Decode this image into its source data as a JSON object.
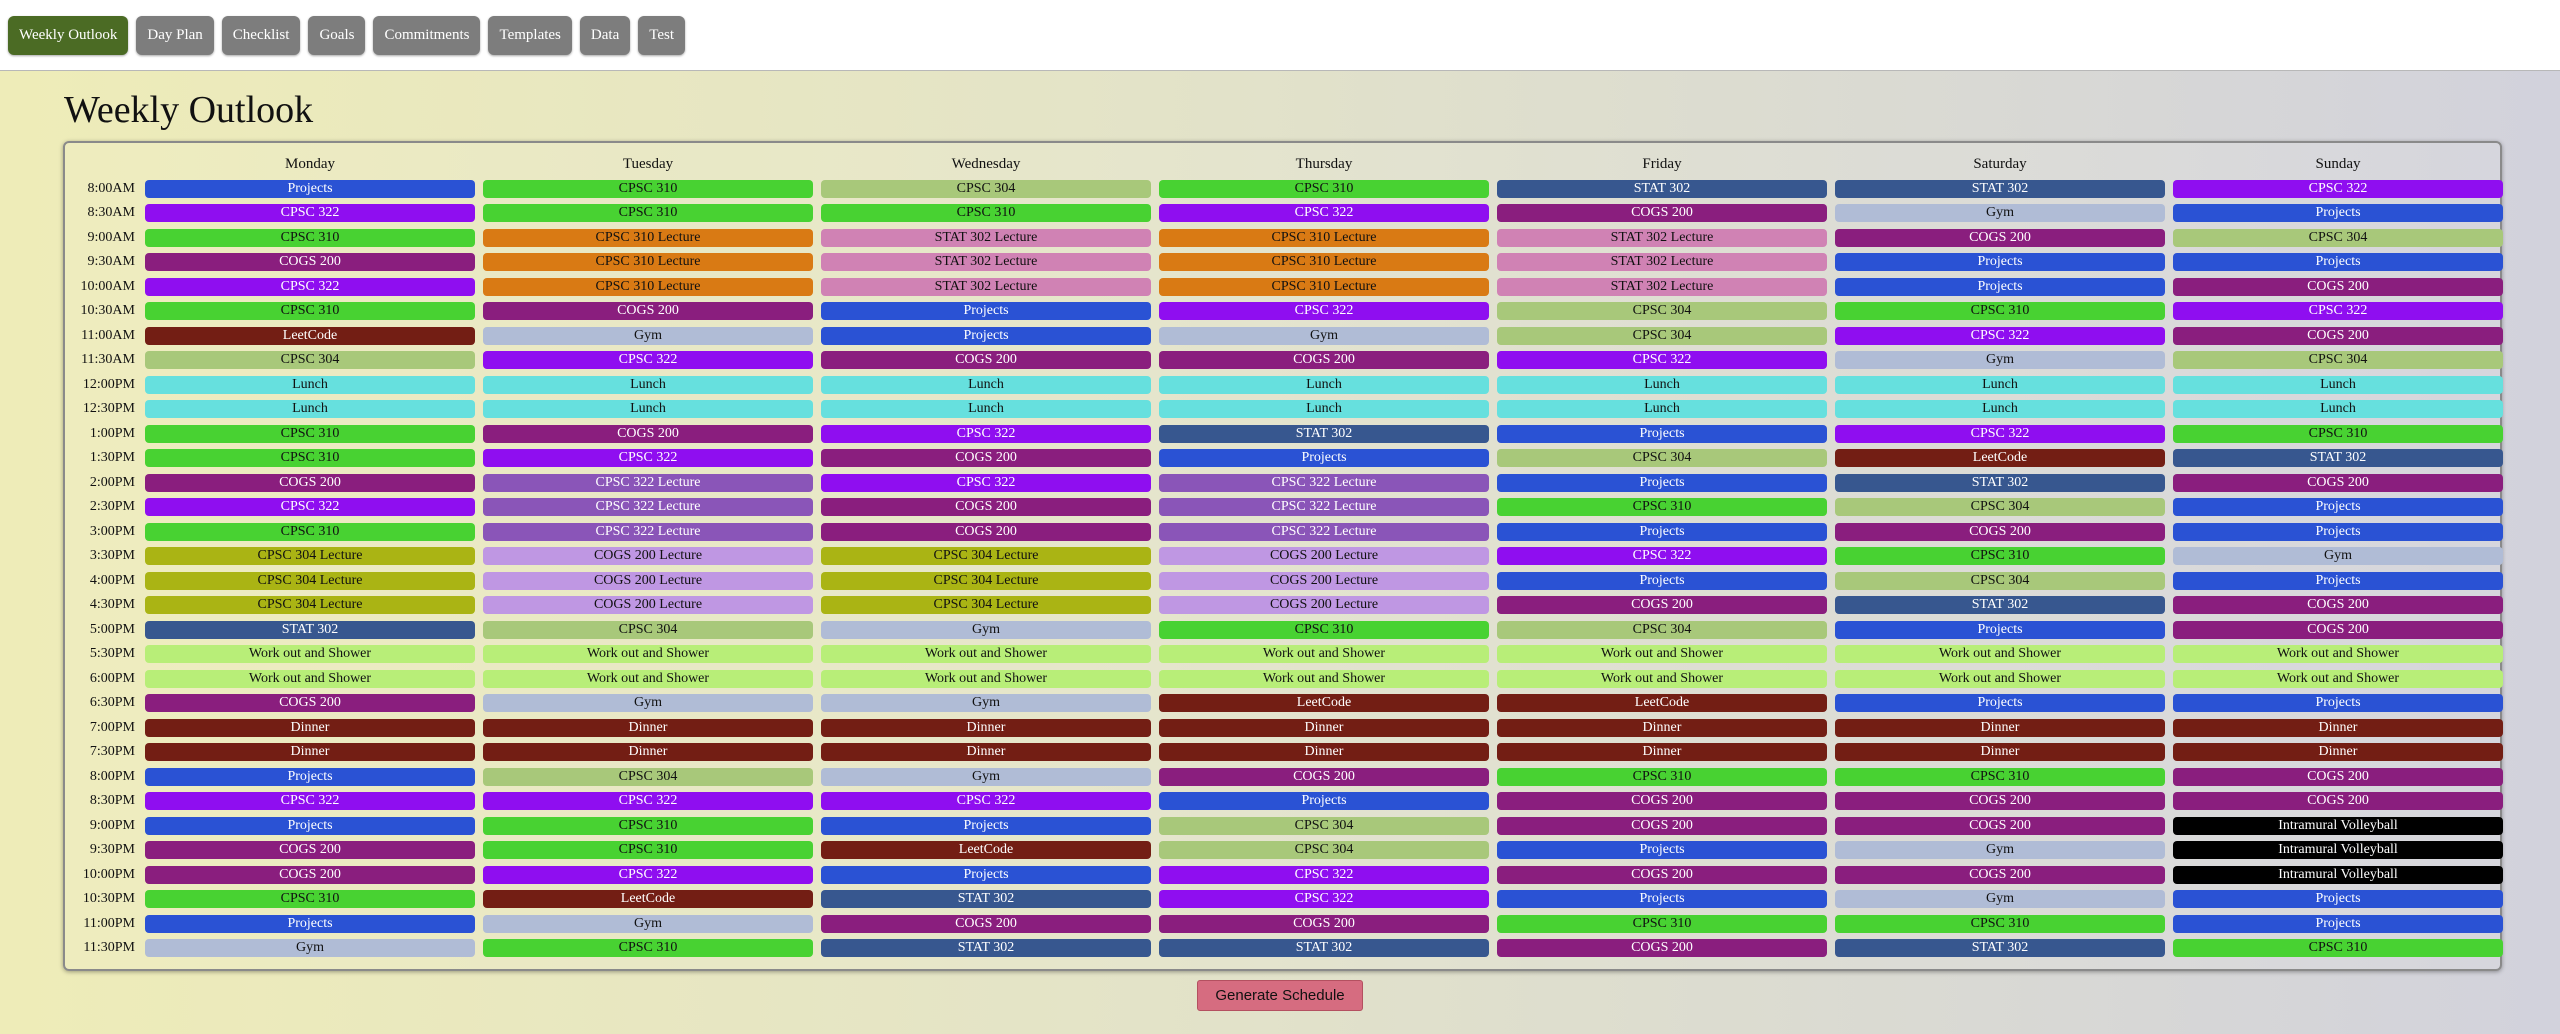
{
  "nav": {
    "items": [
      {
        "label": "Weekly Outlook",
        "active": true
      },
      {
        "label": "Day Plan"
      },
      {
        "label": "Checklist"
      },
      {
        "label": "Goals"
      },
      {
        "label": "Commitments"
      },
      {
        "label": "Templates"
      },
      {
        "label": "Data"
      },
      {
        "label": "Test"
      }
    ]
  },
  "page_title": "Weekly Outlook",
  "schedule": {
    "days": [
      "Monday",
      "Tuesday",
      "Wednesday",
      "Thursday",
      "Friday",
      "Saturday",
      "Sunday"
    ],
    "times": [
      "8:00AM",
      "8:30AM",
      "9:00AM",
      "9:30AM",
      "10:00AM",
      "10:30AM",
      "11:00AM",
      "11:30AM",
      "12:00PM",
      "12:30PM",
      "1:00PM",
      "1:30PM",
      "2:00PM",
      "2:30PM",
      "3:00PM",
      "3:30PM",
      "4:00PM",
      "4:30PM",
      "5:00PM",
      "5:30PM",
      "6:00PM",
      "6:30PM",
      "7:00PM",
      "7:30PM",
      "8:00PM",
      "8:30PM",
      "9:00PM",
      "9:30PM",
      "10:00PM",
      "10:30PM",
      "11:00PM",
      "11:30PM"
    ],
    "rows": [
      [
        "Projects",
        "CPSC 310",
        "CPSC 304",
        "CPSC 310",
        "STAT 302",
        "STAT 302",
        "CPSC 322"
      ],
      [
        "CPSC 322",
        "CPSC 310",
        "CPSC 310",
        "CPSC 322",
        "COGS 200",
        "Gym",
        "Projects"
      ],
      [
        "CPSC 310",
        "CPSC 310 Lecture",
        "STAT 302 Lecture",
        "CPSC 310 Lecture",
        "STAT 302 Lecture",
        "COGS 200",
        "CPSC 304"
      ],
      [
        "COGS 200",
        "CPSC 310 Lecture",
        "STAT 302 Lecture",
        "CPSC 310 Lecture",
        "STAT 302 Lecture",
        "Projects",
        "Projects"
      ],
      [
        "CPSC 322",
        "CPSC 310 Lecture",
        "STAT 302 Lecture",
        "CPSC 310 Lecture",
        "STAT 302 Lecture",
        "Projects",
        "COGS 200"
      ],
      [
        "CPSC 310",
        "COGS 200",
        "Projects",
        "CPSC 322",
        "CPSC 304",
        "CPSC 310",
        "CPSC 322"
      ],
      [
        "LeetCode",
        "Gym",
        "Projects",
        "Gym",
        "CPSC 304",
        "CPSC 322",
        "COGS 200"
      ],
      [
        "CPSC 304",
        "CPSC 322",
        "COGS 200",
        "COGS 200",
        "CPSC 322",
        "Gym",
        "CPSC 304"
      ],
      [
        "Lunch",
        "Lunch",
        "Lunch",
        "Lunch",
        "Lunch",
        "Lunch",
        "Lunch"
      ],
      [
        "Lunch",
        "Lunch",
        "Lunch",
        "Lunch",
        "Lunch",
        "Lunch",
        "Lunch"
      ],
      [
        "CPSC 310",
        "COGS 200",
        "CPSC 322",
        "STAT 302",
        "Projects",
        "CPSC 322",
        "CPSC 310"
      ],
      [
        "CPSC 310",
        "CPSC 322",
        "COGS 200",
        "Projects",
        "CPSC 304",
        "LeetCode",
        "STAT 302"
      ],
      [
        "COGS 200",
        "CPSC 322 Lecture",
        "CPSC 322",
        "CPSC 322 Lecture",
        "Projects",
        "STAT 302",
        "COGS 200"
      ],
      [
        "CPSC 322",
        "CPSC 322 Lecture",
        "COGS 200",
        "CPSC 322 Lecture",
        "CPSC 310",
        "CPSC 304",
        "Projects"
      ],
      [
        "CPSC 310",
        "CPSC 322 Lecture",
        "COGS 200",
        "CPSC 322 Lecture",
        "Projects",
        "COGS 200",
        "Projects"
      ],
      [
        "CPSC 304 Lecture",
        "COGS 200 Lecture",
        "CPSC 304 Lecture",
        "COGS 200 Lecture",
        "CPSC 322",
        "CPSC 310",
        "Gym"
      ],
      [
        "CPSC 304 Lecture",
        "COGS 200 Lecture",
        "CPSC 304 Lecture",
        "COGS 200 Lecture",
        "Projects",
        "CPSC 304",
        "Projects"
      ],
      [
        "CPSC 304 Lecture",
        "COGS 200 Lecture",
        "CPSC 304 Lecture",
        "COGS 200 Lecture",
        "COGS 200",
        "STAT 302",
        "COGS 200"
      ],
      [
        "STAT 302",
        "CPSC 304",
        "Gym",
        "CPSC 310",
        "CPSC 304",
        "Projects",
        "COGS 200"
      ],
      [
        "Work out and Shower",
        "Work out and Shower",
        "Work out and Shower",
        "Work out and Shower",
        "Work out and Shower",
        "Work out and Shower",
        "Work out and Shower"
      ],
      [
        "Work out and Shower",
        "Work out and Shower",
        "Work out and Shower",
        "Work out and Shower",
        "Work out and Shower",
        "Work out and Shower",
        "Work out and Shower"
      ],
      [
        "COGS 200",
        "Gym",
        "Gym",
        "LeetCode",
        "LeetCode",
        "Projects",
        "Projects"
      ],
      [
        "Dinner",
        "Dinner",
        "Dinner",
        "Dinner",
        "Dinner",
        "Dinner",
        "Dinner"
      ],
      [
        "Dinner",
        "Dinner",
        "Dinner",
        "Dinner",
        "Dinner",
        "Dinner",
        "Dinner"
      ],
      [
        "Projects",
        "CPSC 304",
        "Gym",
        "COGS 200",
        "CPSC 310",
        "CPSC 310",
        "COGS 200"
      ],
      [
        "CPSC 322",
        "CPSC 322",
        "CPSC 322",
        "Projects",
        "COGS 200",
        "COGS 200",
        "COGS 200"
      ],
      [
        "Projects",
        "CPSC 310",
        "Projects",
        "CPSC 304",
        "COGS 200",
        "COGS 200",
        "Intramural Volleyball"
      ],
      [
        "COGS 200",
        "CPSC 310",
        "LeetCode",
        "CPSC 304",
        "Projects",
        "Gym",
        "Intramural Volleyball"
      ],
      [
        "COGS 200",
        "CPSC 322",
        "Projects",
        "CPSC 322",
        "COGS 200",
        "COGS 200",
        "Intramural Volleyball"
      ],
      [
        "CPSC 310",
        "LeetCode",
        "STAT 302",
        "CPSC 322",
        "Projects",
        "Gym",
        "Projects"
      ],
      [
        "Projects",
        "Gym",
        "COGS 200",
        "COGS 200",
        "CPSC 310",
        "CPSC 310",
        "Projects"
      ],
      [
        "Gym",
        "CPSC 310",
        "STAT 302",
        "STAT 302",
        "COGS 200",
        "STAT 302",
        "CPSC 310"
      ]
    ]
  },
  "activity_colors": {
    "Projects": {
      "bg": "#2a52d4",
      "fg": "#ffffff"
    },
    "CPSC 310": {
      "bg": "#48d232",
      "fg": "#111111"
    },
    "CPSC 304": {
      "bg": "#a8c87a",
      "fg": "#111111"
    },
    "CPSC 322": {
      "bg": "#8f0ef0",
      "fg": "#ffffff"
    },
    "STAT 302": {
      "bg": "#37578f",
      "fg": "#ffffff"
    },
    "COGS 200": {
      "bg": "#8a1e7e",
      "fg": "#ffffff"
    },
    "Gym": {
      "bg": "#b0bcd6",
      "fg": "#111111"
    },
    "CPSC 310 Lecture": {
      "bg": "#d97a14",
      "fg": "#111111"
    },
    "STAT 302 Lecture": {
      "bg": "#d082b4",
      "fg": "#111111"
    },
    "CPSC 322 Lecture": {
      "bg": "#8a55b8",
      "fg": "#ffffff"
    },
    "CPSC 304 Lecture": {
      "bg": "#aab414",
      "fg": "#111111"
    },
    "COGS 200 Lecture": {
      "bg": "#bf97e3",
      "fg": "#111111"
    },
    "LeetCode": {
      "bg": "#731e14",
      "fg": "#ffffff"
    },
    "Lunch": {
      "bg": "#66e0de",
      "fg": "#111111"
    },
    "Work out and Shower": {
      "bg": "#b8ee78",
      "fg": "#111111"
    },
    "Dinner": {
      "bg": "#731e14",
      "fg": "#ffffff"
    },
    "Intramural Volleyball": {
      "bg": "#000000",
      "fg": "#ffffff"
    }
  },
  "generate_button_label": "Generate Schedule"
}
